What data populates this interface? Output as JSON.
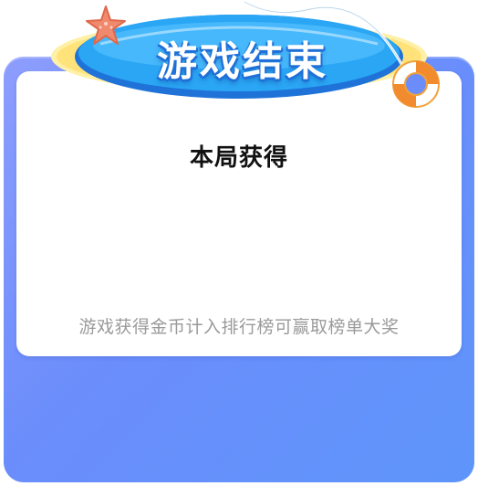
{
  "banner": {
    "title": "游戏结束",
    "star_icon": "starfish-icon",
    "ring_icon": "life-ring-icon"
  },
  "card": {
    "title": "本局获得",
    "hint": "游戏获得金币计入排行榜可赢取榜单大奖"
  },
  "colors": {
    "frame_start": "#8d9dfd",
    "frame_end": "#5e95fb",
    "banner_blue": "#2aa6f5",
    "banner_yellow": "#ffe37a",
    "hint_gray": "#9a9a9a"
  }
}
